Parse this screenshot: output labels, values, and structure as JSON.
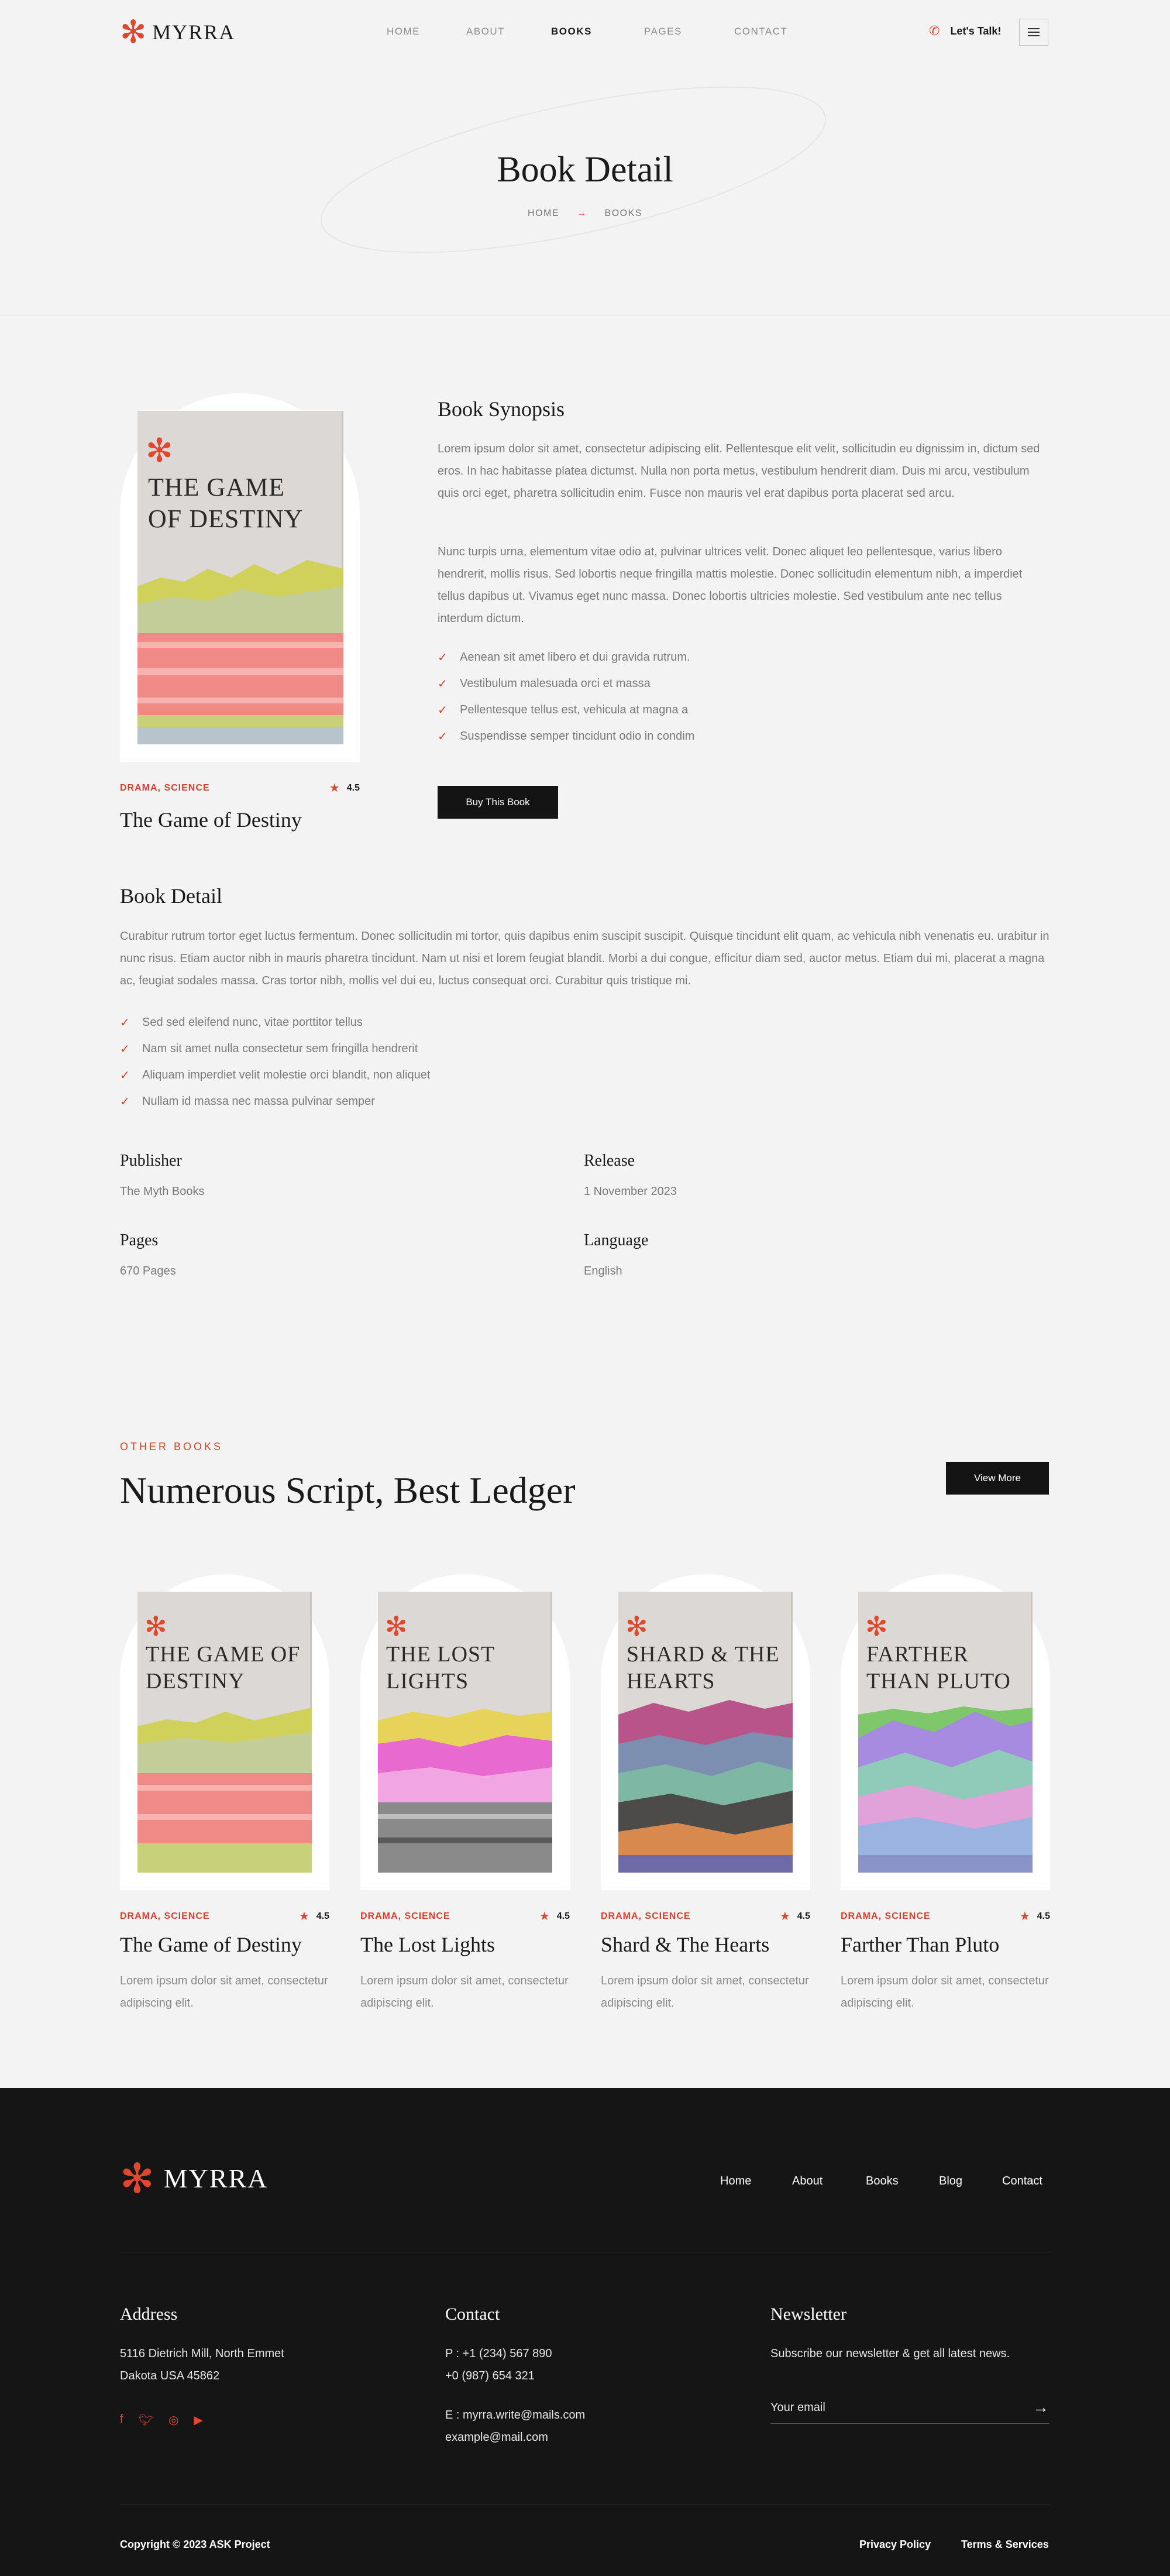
{
  "header": {
    "logo_text": "MYRRA",
    "nav": [
      {
        "label": "HOME",
        "active": false
      },
      {
        "label": "ABOUT",
        "active": false
      },
      {
        "label": "BOOKS",
        "active": true
      },
      {
        "label": "PAGES",
        "active": false
      },
      {
        "label": "CONTACT",
        "active": false
      }
    ],
    "cta_label": "Let's Talk!"
  },
  "hero": {
    "title": "Book Detail",
    "breadcrumb": [
      "HOME",
      "BOOKS"
    ]
  },
  "book": {
    "cover_title": "THE GAME OF DESTINY",
    "genre": "DRAMA, SCIENCE",
    "rating": "4.5",
    "name": "The Game of Destiny",
    "synopsis_heading": "Book Synopsis",
    "synopsis_p1": "Lorem ipsum dolor sit amet, consectetur adipiscing elit. Pellentesque elit velit, sollicitudin eu dignissim in, dictum sed eros. In hac habitasse platea dictumst. Nulla non porta metus, vestibulum hendrerit diam. Duis mi arcu, vestibulum quis orci eget, pharetra sollicitudin enim. Fusce non mauris vel erat dapibus porta placerat sed arcu.",
    "synopsis_p2": "Nunc turpis urna, elementum vitae odio at, pulvinar ultrices velit. Donec aliquet leo pellentesque, varius libero hendrerit, mollis risus. Sed lobortis neque fringilla mattis molestie. Donec sollicitudin elementum nibh, a imperdiet tellus dapibus ut. Vivamus eget nunc massa. Donec lobortis ultricies molestie. Sed vestibulum ante nec tellus interdum dictum.",
    "synopsis_list": [
      "Aenean sit amet libero et dui gravida rutrum.",
      "Vestibulum malesuada orci et massa",
      "Pellentesque tellus est, vehicula at magna a",
      "Suspendisse semper tincidunt odio in condim"
    ],
    "buy_label": "Buy This Book",
    "detail_heading": "Book Detail",
    "detail_p": "Curabitur rutrum tortor eget luctus fermentum. Donec sollicitudin mi tortor, quis dapibus enim suscipit suscipit. Quisque tincidunt elit quam, ac vehicula nibh venenatis eu. urabitur in nunc risus. Etiam auctor nibh in mauris pharetra tincidunt. Nam ut nisi et lorem feugiat blandit. Morbi a dui congue, efficitur diam sed, auctor metus. Etiam dui mi, placerat a magna ac, feugiat sodales massa. Cras tortor nibh, mollis vel dui eu, luctus consequat orci. Curabitur quis tristique mi.",
    "detail_list": [
      "Sed sed eleifend nunc, vitae porttitor tellus",
      "Nam sit amet nulla consectetur sem fringilla hendrerit",
      "Aliquam imperdiet velit molestie orci blandit, non aliquet",
      "Nullam id massa nec massa pulvinar semper"
    ],
    "info": {
      "publisher_label": "Publisher",
      "publisher": "The Myth Books",
      "release_label": "Release",
      "release": "1 November 2023",
      "pages_label": "Pages",
      "pages": "670 Pages",
      "language_label": "Language",
      "language": "English"
    }
  },
  "other_books": {
    "eyebrow": "OTHER BOOKS",
    "title": "Numerous Script, Best Ledger",
    "view_more": "View More",
    "items": [
      {
        "cover": "THE GAME OF DESTINY",
        "genre": "DRAMA, SCIENCE",
        "rating": "4.5",
        "name": "The Game of Destiny",
        "desc": "Lorem ipsum dolor sit amet, consectetur adipiscing elit."
      },
      {
        "cover": "THE LOST LIGHTS",
        "genre": "DRAMA, SCIENCE",
        "rating": "4.5",
        "name": "The Lost Lights",
        "desc": "Lorem ipsum dolor sit amet, consectetur adipiscing elit."
      },
      {
        "cover": "SHARD & THE HEARTS",
        "genre": "DRAMA, SCIENCE",
        "rating": "4.5",
        "name": "Shard & The Hearts",
        "desc": "Lorem ipsum dolor sit amet, consectetur adipiscing elit."
      },
      {
        "cover": "FARTHER THAN PLUTO",
        "genre": "DRAMA, SCIENCE",
        "rating": "4.5",
        "name": "Farther Than Pluto",
        "desc": "Lorem ipsum dolor sit amet, consectetur adipiscing elit."
      }
    ]
  },
  "footer": {
    "logo_text": "MYRRA",
    "nav": [
      "Home",
      "About",
      "Books",
      "Blog",
      "Contact"
    ],
    "address_heading": "Address",
    "address_line1": "5116 Dietrich Mill, North Emmet",
    "address_line2": "Dakota USA 45862",
    "socials": [
      "facebook-icon",
      "twitter-icon",
      "instagram-icon",
      "youtube-icon"
    ],
    "contact_heading": "Contact",
    "phone1": "P : +1 (234) 567 890",
    "phone2": "+0 (987) 654 321",
    "email1": "E : myrra.write@mails.com",
    "email2": "example@mail.com",
    "newsletter_heading": "Newsletter",
    "newsletter_text": "Subscribe our newsletter & get all latest news.",
    "email_placeholder": "Your email",
    "copyright": "Copyright © 2023 ASK Project",
    "links": [
      "Privacy Policy",
      "Terms & Services"
    ]
  },
  "colors": {
    "accent": "#e0472c",
    "dark": "#151515",
    "bg": "#f3f3f3"
  }
}
